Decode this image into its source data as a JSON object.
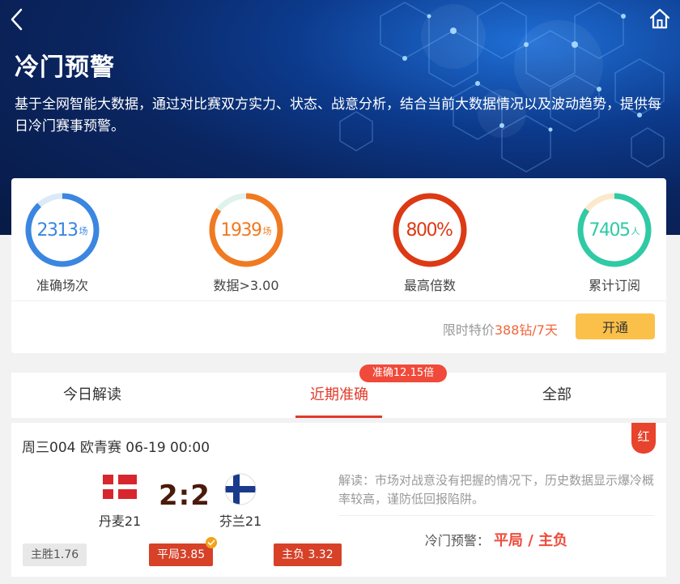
{
  "header": {
    "title": "冷门预警",
    "description": "基于全网智能大数据，通过对比赛双方实力、状态、战意分析，结合当前大数据情况以及波动趋势，提供每日冷门赛事预警。"
  },
  "stats": [
    {
      "value": "2313",
      "unit": "场",
      "label": "准确场次",
      "color": "#3a86e0",
      "track": "#dbe9f8",
      "progress": 0.88
    },
    {
      "value": "1939",
      "unit": "场",
      "label": "数据>3.00",
      "color": "#f07a22",
      "track": "#dff3ec",
      "progress": 0.85
    },
    {
      "value": "800%",
      "unit": "",
      "label": "最高倍数",
      "color": "#dc3a15",
      "track": "#f6d6cc",
      "progress": 1.0
    },
    {
      "value": "7405",
      "unit": "人",
      "label": "累计订阅",
      "color": "#2fcaa6",
      "track": "#fbe9cc",
      "progress": 0.85
    }
  ],
  "promo": {
    "prefix": "限时特价",
    "price": "388钻/7天",
    "button": "开通"
  },
  "tabs": {
    "items": [
      "今日解读",
      "近期准确",
      "全部"
    ],
    "active_index": 1,
    "badge": "准确12.15倍"
  },
  "match": {
    "header": "周三004 欧青赛 06-19 00:00",
    "result_tag": "红",
    "home_team": "丹麦21",
    "away_team": "芬兰21",
    "score": "2:2",
    "analysis": "解读：市场对战意没有把握的情况下，历史数据显示爆冷概率较高，谨防低回报陷阱。",
    "warning_label": "冷门预警：",
    "warning_pick": "平局 / 主负",
    "odds": [
      {
        "label": "主胜1.76",
        "style": "gray"
      },
      {
        "label": "平局3.85",
        "style": "red",
        "checked": true
      },
      {
        "label": "主负 3.32",
        "style": "red"
      }
    ]
  },
  "colors": {
    "accent_red": "#e03a2a",
    "button_yellow": "#fbc04a",
    "price_orange": "#f0663b"
  },
  "icons": {
    "back": "chevron-left-icon",
    "home": "home-icon",
    "denmark_flag": "denmark-flag-icon",
    "finland_flag": "finland-flag-icon",
    "check": "check-badge-icon"
  }
}
